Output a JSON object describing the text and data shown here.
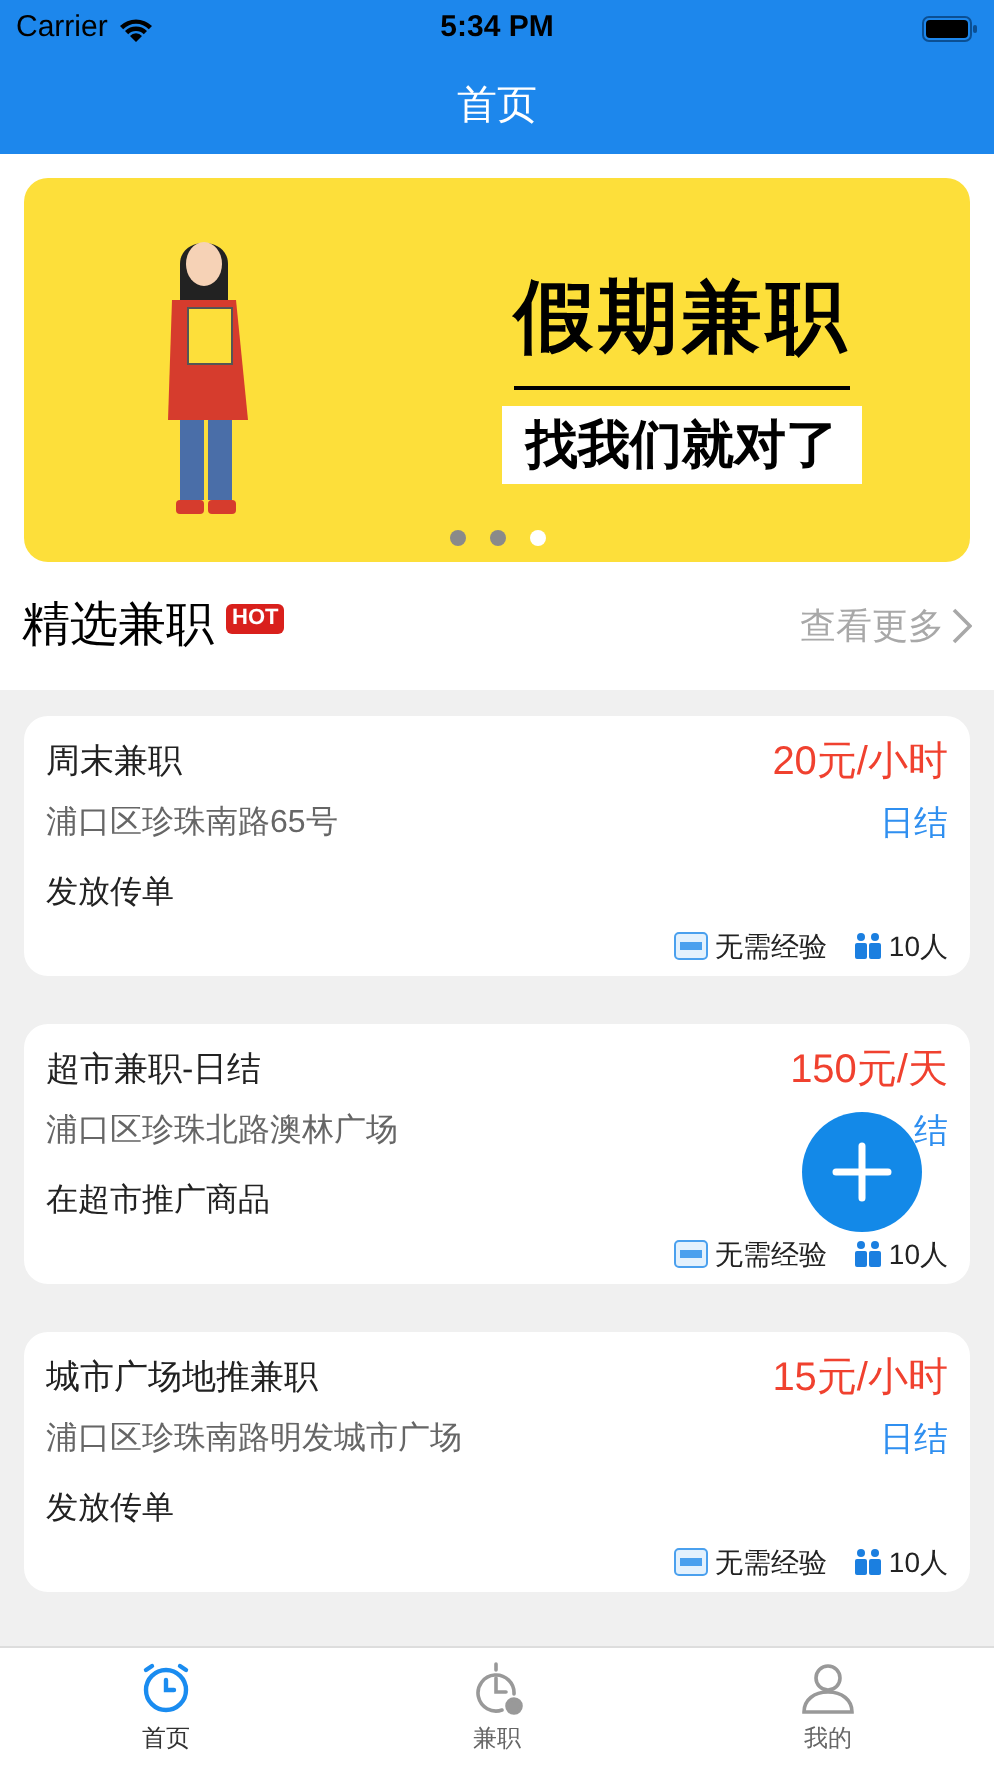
{
  "status_bar": {
    "carrier": "Carrier",
    "time": "5:34 PM"
  },
  "nav_bar": {
    "title": "首页"
  },
  "banner": {
    "headline": "假期兼职",
    "subline": "找我们就对了",
    "dots": [
      {
        "selected": false
      },
      {
        "selected": false
      },
      {
        "selected": true
      }
    ]
  },
  "section": {
    "title": "精选兼职",
    "badge": "HOT",
    "more": "查看更多"
  },
  "jobs": [
    {
      "title": "周末兼职",
      "pay": "20元/小时",
      "address": "浦口区珍珠南路65号",
      "settlement": "日结",
      "description": "发放传单",
      "experience": "无需经验",
      "headcount": "10人"
    },
    {
      "title": "超市兼职-日结",
      "pay": "150元/天",
      "address": "浦口区珍珠北路澳林广场",
      "settlement": "结",
      "description": "在超市推广商品",
      "experience": "无需经验",
      "headcount": "10人"
    },
    {
      "title": "城市广场地推兼职",
      "pay": "15元/小时",
      "address": "浦口区珍珠南路明发城市广场",
      "settlement": "日结",
      "description": "发放传单",
      "experience": "无需经验",
      "headcount": "10人"
    }
  ],
  "tab_bar": [
    {
      "kind": "home",
      "label": "首页",
      "selected": true
    },
    {
      "kind": "jobs",
      "label": "兼职",
      "selected": false
    },
    {
      "kind": "profile",
      "label": "我的",
      "selected": false
    }
  ]
}
